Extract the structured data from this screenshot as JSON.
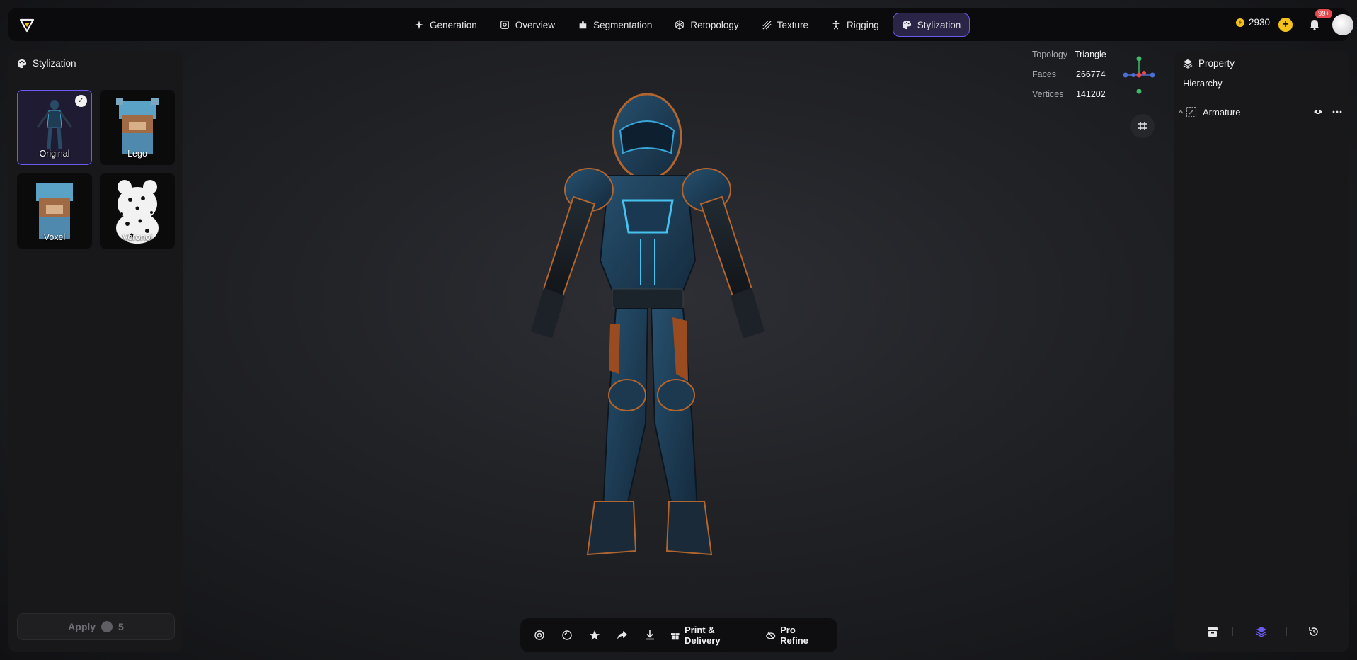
{
  "nav": {
    "items": [
      {
        "label": "Generation",
        "icon": "sparkle-icon",
        "active": false
      },
      {
        "label": "Overview",
        "icon": "focus-icon",
        "active": false
      },
      {
        "label": "Segmentation",
        "icon": "puzzle-icon",
        "active": false
      },
      {
        "label": "Retopology",
        "icon": "mesh-icon",
        "active": false
      },
      {
        "label": "Texture",
        "icon": "texture-icon",
        "active": false
      },
      {
        "label": "Rigging",
        "icon": "figure-icon",
        "active": false
      },
      {
        "label": "Stylization",
        "icon": "palette-icon",
        "active": true
      }
    ]
  },
  "header": {
    "credits": "2930",
    "notification_badge": "99+"
  },
  "left_panel": {
    "title": "Stylization",
    "styles": [
      {
        "label": "Original",
        "selected": true
      },
      {
        "label": "Lego",
        "selected": false
      },
      {
        "label": "Voxel",
        "selected": false
      },
      {
        "label": "Voronoi",
        "selected": false
      }
    ],
    "apply": {
      "label": "Apply",
      "cost": "5"
    }
  },
  "stats": {
    "topology_label": "Topology",
    "topology_value": "Triangle",
    "faces_label": "Faces",
    "faces_value": "266774",
    "vertices_label": "Vertices",
    "vertices_value": "141202"
  },
  "right_panel": {
    "title": "Property",
    "hierarchy_label": "Hierarchy",
    "tree": [
      {
        "label": "Armature"
      }
    ]
  },
  "toolbar": {
    "print_label": "Print & Delivery",
    "refine_label": "Pro Refine"
  },
  "colors": {
    "accent": "#6a5cf0",
    "coin": "#f5c21b",
    "badge": "#e5484d",
    "panel": "#18181b"
  }
}
